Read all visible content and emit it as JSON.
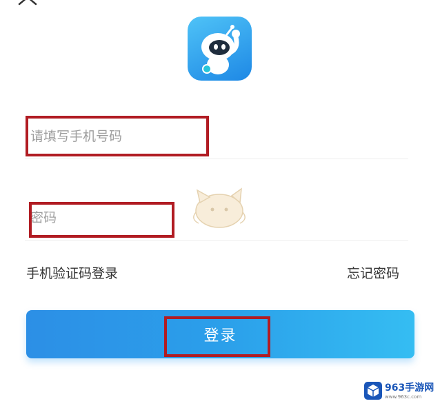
{
  "header": {
    "close_icon": "close-icon"
  },
  "logo": {
    "icon": "robot-app-icon",
    "colors": {
      "bg_top": "#4fc3f7",
      "bg_bottom": "#1e88e5"
    }
  },
  "form": {
    "phone": {
      "placeholder": "请填写手机号码",
      "value": ""
    },
    "password": {
      "placeholder": "密码",
      "value": ""
    },
    "sms_login_link": "手机验证码登录",
    "forgot_password_link": "忘记密码",
    "login_button": "登录"
  },
  "highlight_color": "#b11c23",
  "watermark": {
    "title": "963手游网",
    "url": "www.963c.com"
  }
}
